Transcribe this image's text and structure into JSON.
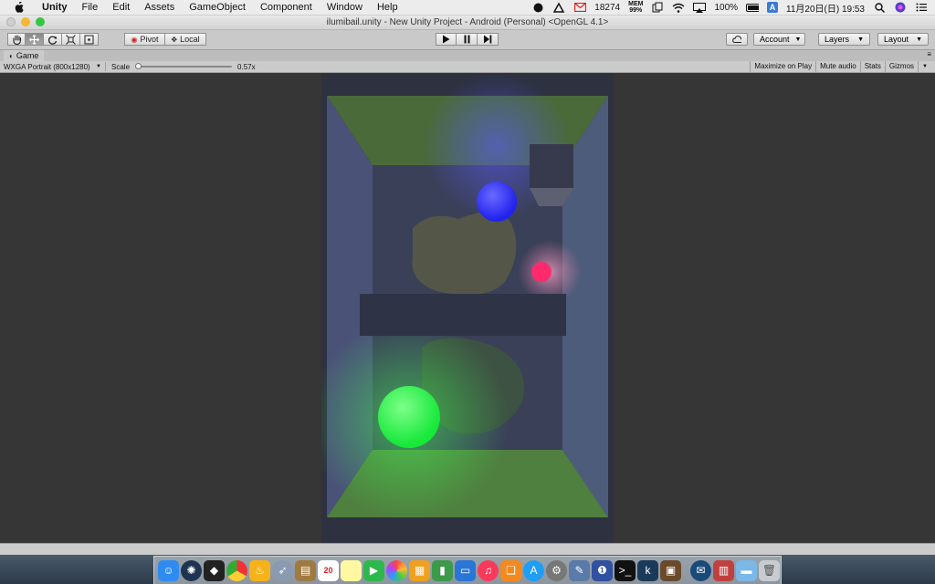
{
  "menubar": {
    "app": "Unity",
    "items": [
      "File",
      "Edit",
      "Assets",
      "GameObject",
      "Component",
      "Window",
      "Help"
    ],
    "mail_count": "18274",
    "mem_label": "MEM",
    "mem_value": "99%",
    "battery": "100%",
    "input_badge": "A",
    "datetime": "11月20日(日)  19:53"
  },
  "window": {
    "title": "ilumibail.unity - New Unity Project - Android (Personal) <OpenGL 4.1>"
  },
  "toolbar": {
    "pivot_label": "Pivot",
    "local_label": "Local",
    "account_label": "Account",
    "layers_label": "Layers",
    "layout_label": "Layout"
  },
  "game": {
    "tab_label": "Game",
    "resolution": "WXGA Portrait (800x1280)",
    "scale_label": "Scale",
    "scale_value": "0.57x",
    "scale_fraction": 0.0,
    "maximize_label": "Maximize on Play",
    "mute_label": "Mute audio",
    "stats_label": "Stats",
    "gizmos_label": "Gizmos"
  },
  "colors": {
    "accent_blue": "#3b3bff",
    "accent_pink": "#ff2a6d",
    "accent_green": "#22ff44",
    "room_green": "#4f7a3e",
    "room_purple": "#4a4f7e"
  },
  "dock": {
    "calendar_day": "20"
  }
}
